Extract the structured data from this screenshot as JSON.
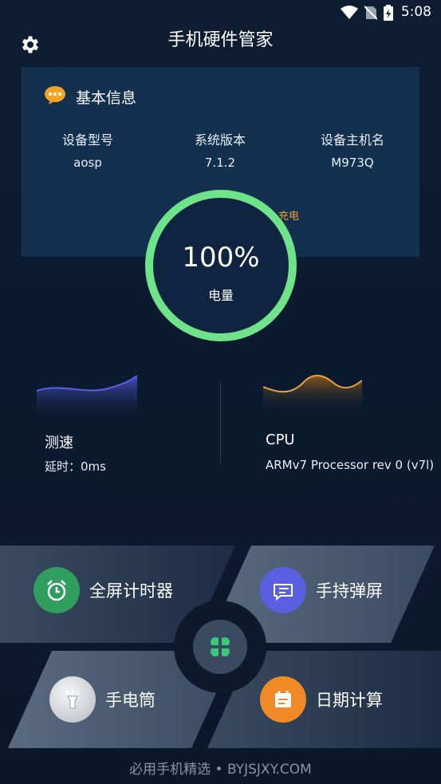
{
  "status_bar": {
    "time": "5:08"
  },
  "header": {
    "title": "手机硬件管家"
  },
  "info_card": {
    "title": "基本信息",
    "columns": [
      {
        "label": "设备型号",
        "value": "aosp"
      },
      {
        "label": "系统版本",
        "value": "7.1.2"
      },
      {
        "label": "设备主机名",
        "value": "M973Q"
      }
    ],
    "charging_status": "充电"
  },
  "battery": {
    "percent_text": "100%",
    "label": "电量",
    "level": 1.0,
    "ring_color": "#6fe38a"
  },
  "speed": {
    "title": "测速",
    "detail": "延时：0ms"
  },
  "cpu": {
    "title": "CPU",
    "detail": "ARMv7 Processor rev 0 (v7l)"
  },
  "tools": [
    {
      "label": "全屏计时器",
      "icon": "alarm-clock-icon",
      "color": "#2f9e5f"
    },
    {
      "label": "手持弹屏",
      "icon": "chat-bubble-icon",
      "color": "#5a5fe0"
    },
    {
      "label": "手电筒",
      "icon": "flashlight-icon",
      "color": "#c9ccd2"
    },
    {
      "label": "日期计算",
      "icon": "calendar-icon",
      "color": "#f08a24"
    }
  ],
  "footer": {
    "watermark": "必用手机精选 • BYJSJXY.COM"
  }
}
